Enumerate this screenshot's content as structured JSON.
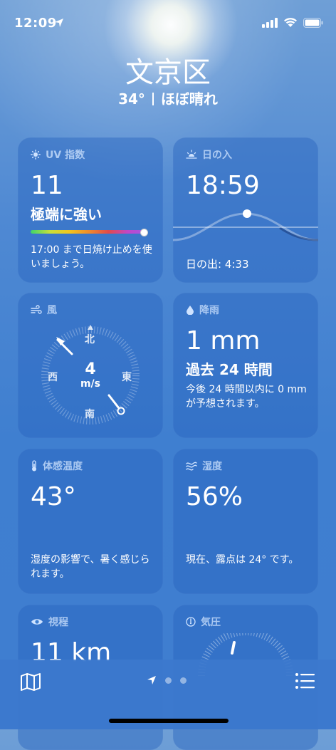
{
  "status_bar": {
    "time": "12:09"
  },
  "header": {
    "city": "文京区",
    "temperature": "34°",
    "condition": "ほぼ晴れ"
  },
  "cards": {
    "uv": {
      "title": "UV 指数",
      "value": "11",
      "level": "極端に強い",
      "advice": "17:00 まで日焼け止めを使いましょう。",
      "bar_fraction": 0.97
    },
    "sunset": {
      "title": "日の入",
      "value": "18:59",
      "sunrise": "日の出: 4:33"
    },
    "wind": {
      "title": "風",
      "speed": "4",
      "unit": "m/s",
      "north": "北",
      "south": "南",
      "east": "東",
      "west": "西"
    },
    "rain": {
      "title": "降雨",
      "value": "1 mm",
      "period": "過去 24 時間",
      "forecast": "今後 24 時間以内に 0 mm が予想されます。"
    },
    "feels_like": {
      "title": "体感温度",
      "value": "43°",
      "desc": "湿度の影響で、暑く感じられます。"
    },
    "humidity": {
      "title": "湿度",
      "value": "56%",
      "desc": "現在、露点は 24° です。"
    },
    "visibility": {
      "title": "視程",
      "value": "11 km"
    },
    "pressure": {
      "title": "気圧"
    }
  }
}
